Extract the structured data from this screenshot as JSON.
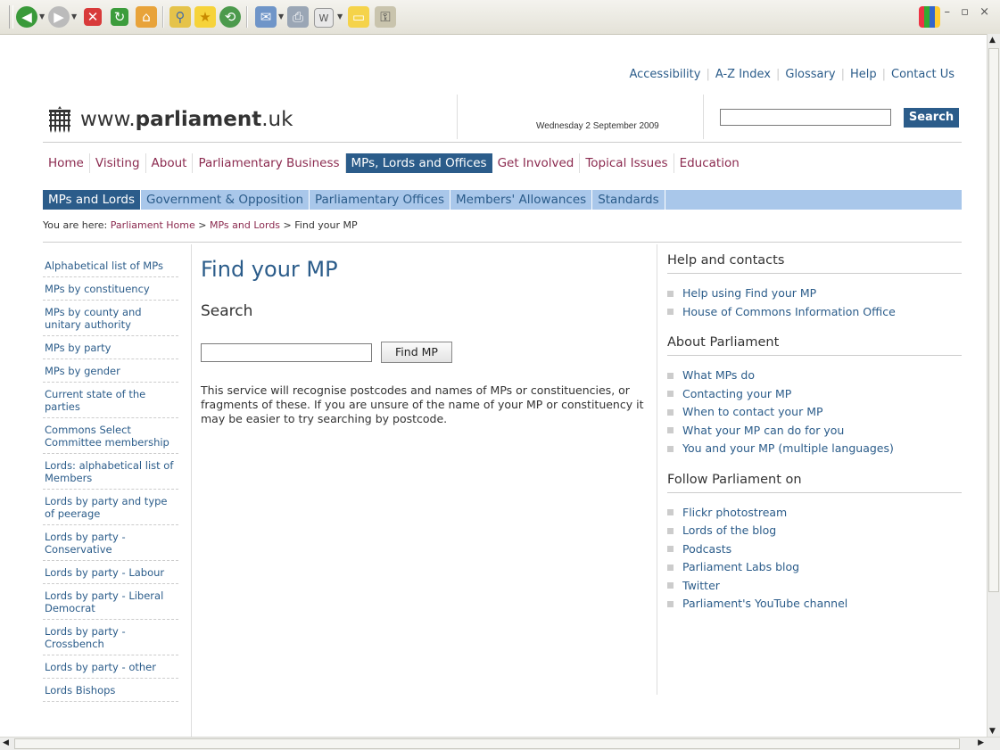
{
  "header": {
    "util_links": [
      "Accessibility",
      "A-Z Index",
      "Glossary",
      "Help",
      "Contact Us"
    ],
    "site_prefix": "www.",
    "site_bold": "parliament",
    "site_suffix": ".uk",
    "date": "Wednesday 2 September 2009",
    "search_button": "Search"
  },
  "main_nav": [
    "Home",
    "Visiting",
    "About",
    "Parliamentary Business",
    "MPs, Lords and Offices",
    "Get Involved",
    "Topical Issues",
    "Education"
  ],
  "main_nav_active": "MPs, Lords and Offices",
  "sub_nav": [
    "MPs and Lords",
    "Government & Opposition",
    "Parliamentary Offices",
    "Members' Allowances",
    "Standards"
  ],
  "sub_nav_active": "MPs and Lords",
  "breadcrumb": {
    "prefix": "You are here:",
    "home": "Parliament Home",
    "sep1": ">",
    "section": "MPs and Lords",
    "sep2": ">",
    "current": "Find your MP"
  },
  "left_nav": [
    "Alphabetical list of MPs",
    "MPs by constituency",
    "MPs by county and unitary authority",
    "MPs by party",
    "MPs by gender",
    "Current state of the parties",
    "Commons Select Committee membership",
    "Lords: alphabetical list of Members",
    "Lords by party and type of peerage",
    "Lords by party - Conservative",
    "Lords by party - Labour",
    "Lords by party - Liberal Democrat",
    "Lords by party - Crossbench",
    "Lords by party - other",
    "Lords Bishops"
  ],
  "main": {
    "title": "Find your MP",
    "search_heading": "Search",
    "find_button": "Find MP",
    "description": "This service will recognise postcodes and names of MPs or constituencies, or fragments of these. If you are unsure of the name of your MP or constituency it may be easier to try searching by postcode."
  },
  "right": {
    "sections": [
      {
        "heading": "Help and contacts",
        "items": [
          "Help using Find your MP",
          "House of Commons Information Office"
        ]
      },
      {
        "heading": "About Parliament",
        "items": [
          "What MPs do",
          "Contacting your MP",
          "When to contact your MP",
          "What your MP can do for you",
          "You and your MP (multiple languages)"
        ]
      },
      {
        "heading": "Follow Parliament on",
        "items": [
          "Flickr photostream",
          "Lords of the blog",
          "Podcasts",
          "Parliament Labs blog",
          "Twitter",
          "Parliament's YouTube channel"
        ]
      }
    ]
  },
  "browser": {
    "toolbar_icons": [
      "back-icon",
      "forward-icon",
      "stop-icon",
      "refresh-icon",
      "home-icon",
      "search-icon",
      "favorites-icon",
      "history-icon",
      "mail-icon",
      "print-icon",
      "edit-icon",
      "folder-icon",
      "research-icon"
    ],
    "window_controls": "– ▫ ×"
  },
  "colors": {
    "link_blue": "#2b5c8a",
    "nav_maroon": "#8b2a4f",
    "subnav_bg": "#a9c7ea"
  }
}
